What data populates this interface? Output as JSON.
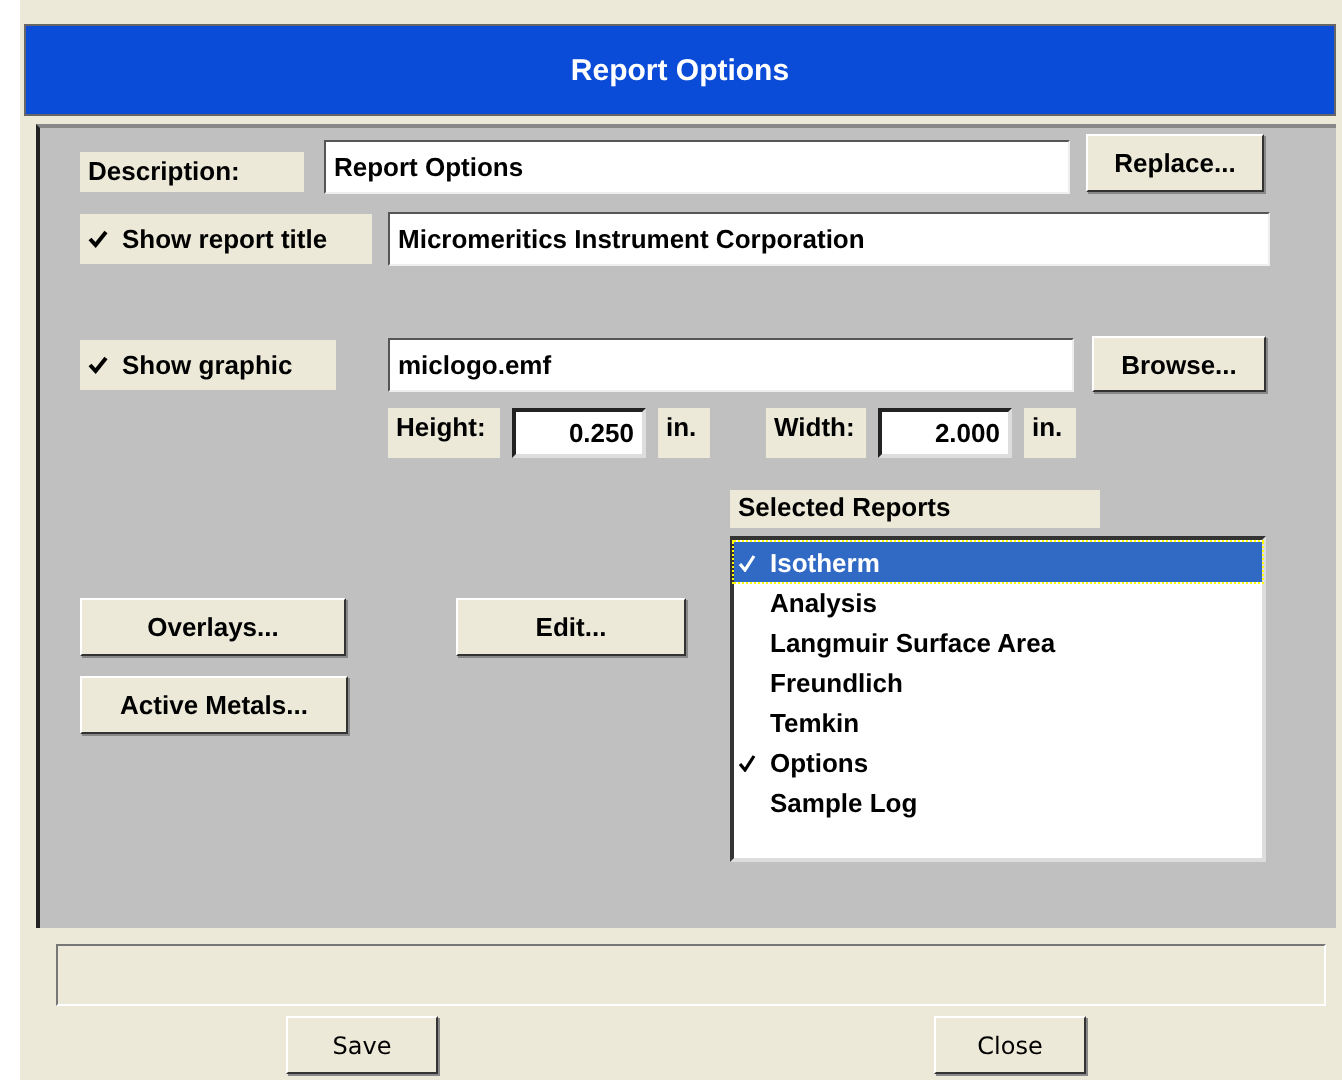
{
  "window": {
    "title": "Report Options"
  },
  "description": {
    "label": "Description:",
    "value": "Report Options",
    "button": "Replace..."
  },
  "show_report_title": {
    "label": "Show report title",
    "checked": true,
    "value": "Micromeritics Instrument Corporation"
  },
  "show_graphic": {
    "label": "Show graphic",
    "checked": true,
    "value": "miclogo.emf",
    "button": "Browse..."
  },
  "height": {
    "label": "Height:",
    "value": "0.250",
    "unit": "in."
  },
  "width": {
    "label": "Width:",
    "value": "2.000",
    "unit": "in."
  },
  "buttons": [
    "Overlays...",
    "Edit...",
    "Active Metals..."
  ],
  "selected_reports": {
    "label": "Selected Reports",
    "items": [
      {
        "label": "Isotherm",
        "checked": true,
        "selected": true
      },
      {
        "label": "Analysis",
        "checked": false,
        "selected": false
      },
      {
        "label": "Langmuir Surface Area",
        "checked": false,
        "selected": false
      },
      {
        "label": "Freundlich",
        "checked": false,
        "selected": false
      },
      {
        "label": "Temkin",
        "checked": false,
        "selected": false
      },
      {
        "label": "Options",
        "checked": true,
        "selected": false
      },
      {
        "label": "Sample Log",
        "checked": false,
        "selected": false
      }
    ]
  },
  "footer_buttons": [
    "Save",
    "Close"
  ]
}
